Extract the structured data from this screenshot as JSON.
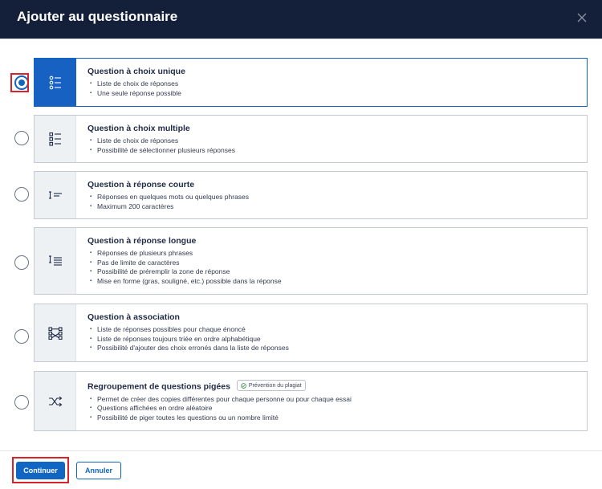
{
  "dialog": {
    "title": "Ajouter au questionnaire",
    "close_icon": "close-icon"
  },
  "options": [
    {
      "title": "Question à choix unique",
      "icon": "single-choice-icon",
      "selected": true,
      "bullets": [
        "Liste de choix de réponses",
        "Une seule réponse possible"
      ]
    },
    {
      "title": "Question à choix multiple",
      "icon": "multiple-choice-icon",
      "selected": false,
      "bullets": [
        "Liste de choix de réponses",
        "Possibilité de sélectionner plusieurs réponses"
      ]
    },
    {
      "title": "Question à réponse courte",
      "icon": "short-answer-icon",
      "selected": false,
      "bullets": [
        "Réponses en quelques mots ou quelques phrases",
        "Maximum 200 caractères"
      ]
    },
    {
      "title": "Question à réponse longue",
      "icon": "long-answer-icon",
      "selected": false,
      "bullets": [
        "Réponses de plusieurs phrases",
        "Pas de limite de caractères",
        "Possibilité de préremplir la zone de réponse",
        "Mise en forme (gras, souligné, etc.) possible dans la réponse"
      ]
    },
    {
      "title": "Question à association",
      "icon": "matching-icon",
      "selected": false,
      "bullets": [
        "Liste de réponses possibles pour chaque énoncé",
        "Liste de réponses toujours triée en ordre alphabétique",
        "Possibilité d'ajouter des choix erronés dans la liste de réponses"
      ]
    },
    {
      "title": "Regroupement de questions pigées",
      "icon": "shuffle-icon",
      "selected": false,
      "badge": "Prévention du plagiat",
      "bullets": [
        "Permet de créer des copies différentes pour chaque personne ou pour chaque essai",
        "Questions affichées en ordre aléatoire",
        "Possibilité de piger toutes les questions ou un nombre limité"
      ]
    }
  ],
  "footer": {
    "continue_label": "Continuer",
    "cancel_label": "Annuler"
  },
  "colors": {
    "header_bg": "#14203a",
    "accent": "#1166c4",
    "highlight": "#d8232a"
  }
}
